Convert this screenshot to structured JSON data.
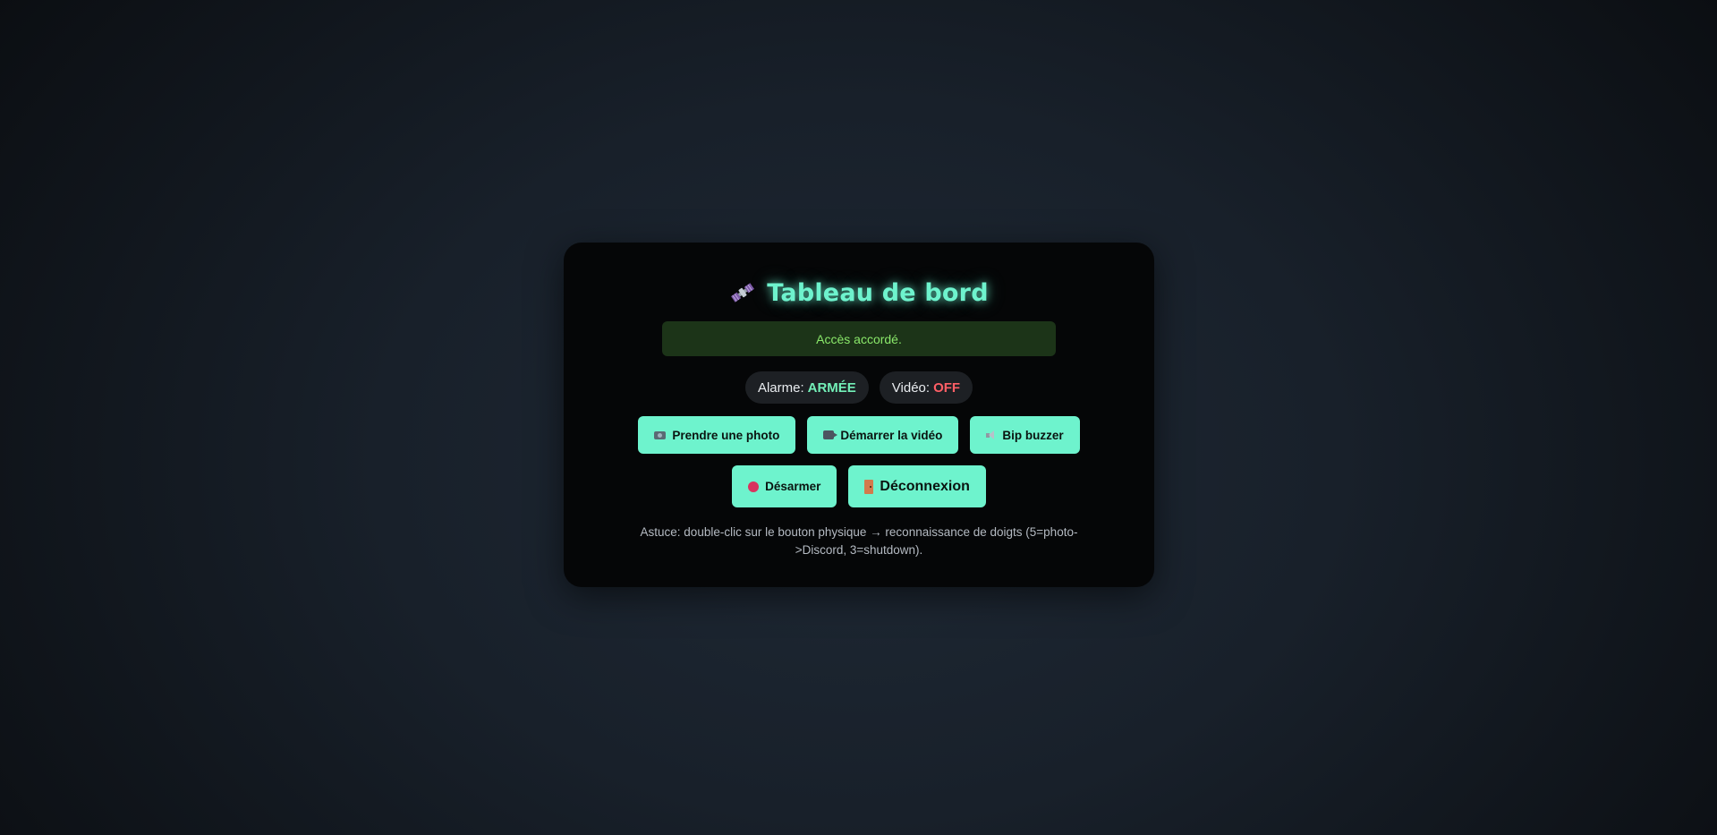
{
  "dashboard": {
    "title": "Tableau de bord",
    "title_icon": "satellite-icon",
    "alert_message": "Accès accordé.",
    "colors": {
      "accent": "#6ef3cd",
      "alert_bg": "#1c3418",
      "alert_text": "#8ae86a",
      "armed": "#73f0b8",
      "off": "#ff5f66"
    }
  },
  "status": {
    "alarm_label": "Alarme:",
    "alarm_value": "ARMÉE",
    "video_label": "Vidéo:",
    "video_value": "OFF"
  },
  "actions": {
    "photo": {
      "label": "Prendre une photo",
      "icon": "camera-icon"
    },
    "video": {
      "label": "Démarrer la vidéo",
      "icon": "video-camera-icon"
    },
    "buzzer": {
      "label": "Bip buzzer",
      "icon": "speaker-icon"
    },
    "disarm": {
      "label": "Désarmer",
      "icon": "red-circle-icon"
    },
    "logout": {
      "label": "Déconnexion",
      "icon": "door-icon"
    }
  },
  "hint": "Astuce: double-clic sur le bouton physique → reconnaissance de doigts (5=photo->Discord, 3=shutdown)."
}
